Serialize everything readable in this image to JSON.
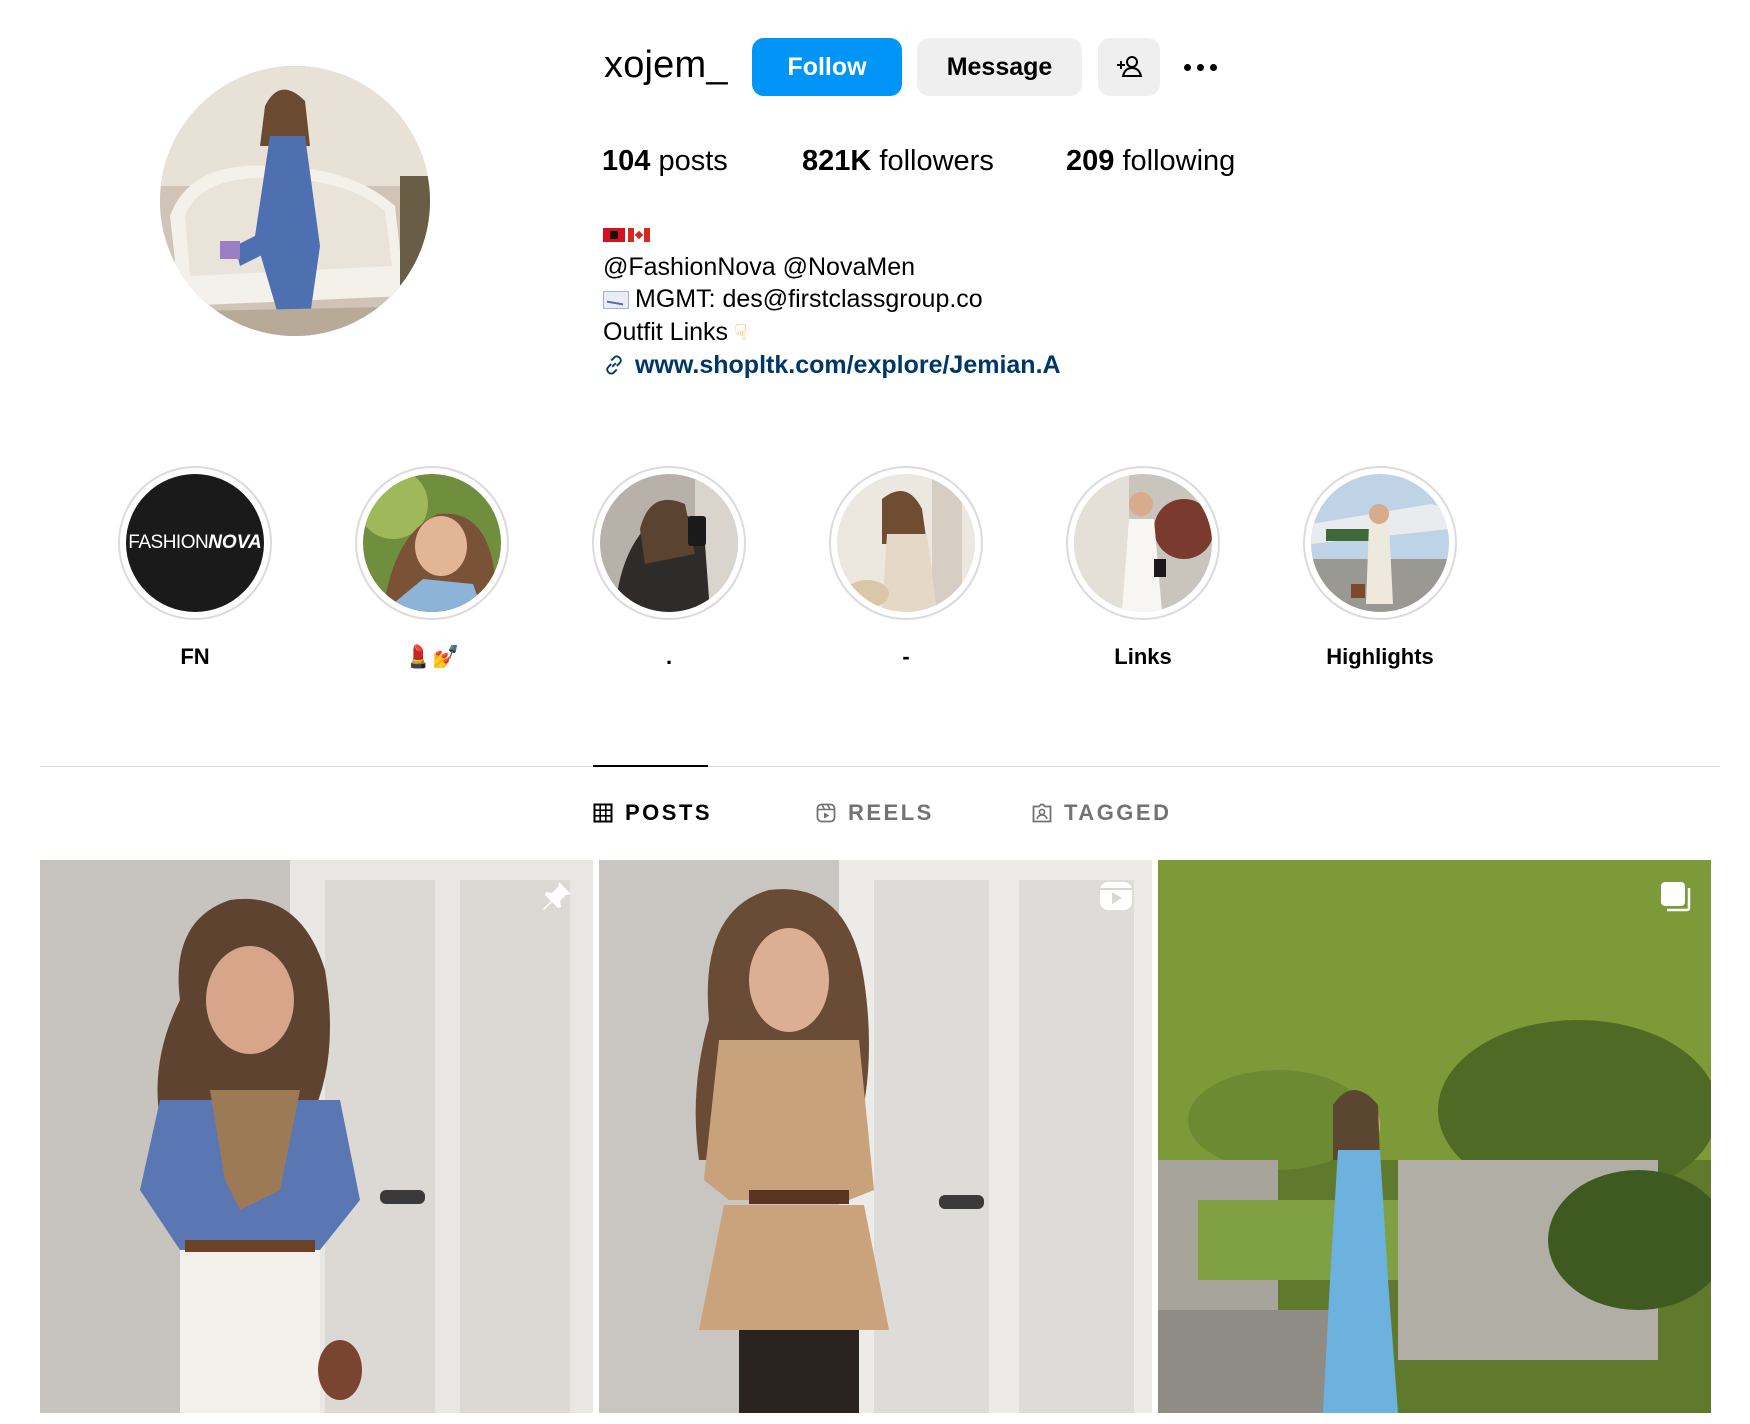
{
  "profile": {
    "username": "xojem_",
    "buttons": {
      "follow": "Follow",
      "message": "Message"
    },
    "icons": {
      "suggest": "add-person-icon",
      "more": "more-options-icon"
    }
  },
  "stats": [
    {
      "count": "104",
      "label": "posts"
    },
    {
      "count": "821K",
      "label": "followers"
    },
    {
      "count": "209",
      "label": "following"
    }
  ],
  "bio": {
    "flags": [
      "albania-flag",
      "canada-flag"
    ],
    "line_mentions": "@FashionNova @NovaMen",
    "line_mgmt": "MGMT: des@firstclassgroup.co",
    "line_outfit": "Outfit Links",
    "link": "www.shopltk.com/explore/Jemian.A"
  },
  "highlights": [
    {
      "label": "FN",
      "logo_text": "FASHION",
      "logo_text_bold": "NOVA"
    },
    {
      "label": "💄💅"
    },
    {
      "label": "."
    },
    {
      "label": "-"
    },
    {
      "label": "Links"
    },
    {
      "label": "Highlights"
    }
  ],
  "tabs": [
    {
      "label": "POSTS",
      "icon": "grid-icon",
      "active": true
    },
    {
      "label": "REELS",
      "icon": "reels-icon",
      "active": false
    },
    {
      "label": "TAGGED",
      "icon": "tagged-icon",
      "active": false
    }
  ],
  "posts": [
    {
      "badge": "pin-icon"
    },
    {
      "badge": "reel-icon"
    },
    {
      "badge": "carousel-icon"
    }
  ],
  "colors": {
    "accent": "#0095f6",
    "link": "#00376b",
    "secondary_button": "#efefef",
    "muted_text": "#737373",
    "divider": "#dbdbdb"
  }
}
